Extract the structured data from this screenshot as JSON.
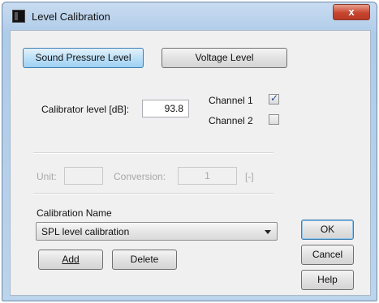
{
  "window": {
    "title": "Level Calibration",
    "close_glyph": "x"
  },
  "mode_tabs": {
    "spl_label": "Sound Pressure Level",
    "voltage_label": "Voltage Level"
  },
  "calibrator": {
    "label": "Calibrator level [dB]:",
    "value": "93.8"
  },
  "channels": [
    {
      "label": "Channel 1",
      "checked": true
    },
    {
      "label": "Channel 2",
      "checked": false
    }
  ],
  "unit_row": {
    "unit_label": "Unit:",
    "unit_value": "",
    "conversion_label": "Conversion:",
    "conversion_value": "1",
    "bracket_label": "[-]"
  },
  "calibration_name": {
    "label": "Calibration Name",
    "selected": "SPL level calibration"
  },
  "buttons": {
    "add": "Add",
    "delete": "Delete",
    "ok": "OK",
    "cancel": "Cancel",
    "help": "Help"
  },
  "colors": {
    "title_bar": "#aecbe9",
    "active_tab": "#bde0f8",
    "close_button": "#c8452f",
    "check": "#2a4a9a"
  }
}
